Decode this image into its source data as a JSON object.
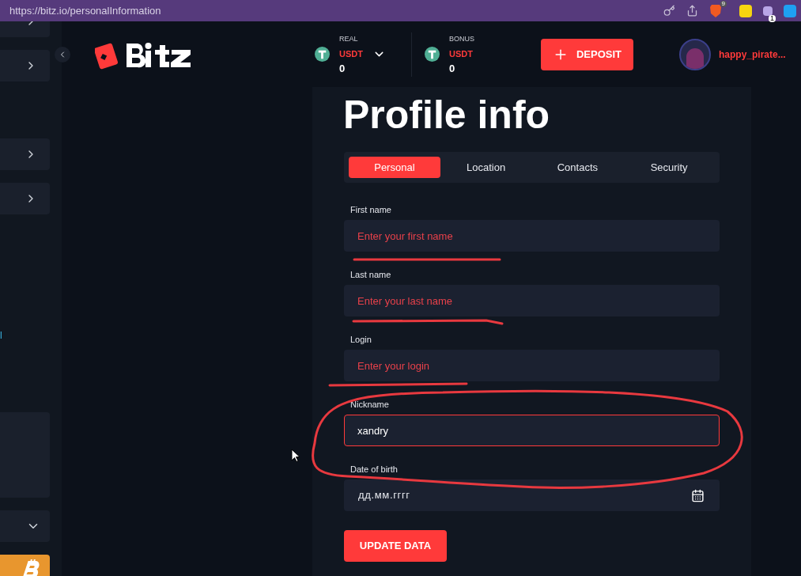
{
  "browser": {
    "url": "https://bitz.io/personalInformation",
    "brave_badge": "9",
    "extension_badge": "1"
  },
  "sidebar": {
    "items": [
      {
        "kind": "chevron"
      },
      {
        "kind": "chevron"
      },
      {
        "kind": "chevron"
      },
      {
        "kind": "chevron"
      },
      {
        "kind": "text",
        "text": "l"
      },
      {
        "kind": "panel"
      },
      {
        "kind": "dropdown"
      },
      {
        "kind": "bitcoin"
      }
    ]
  },
  "header": {
    "balances": [
      {
        "label": "REAL",
        "currency": "USDT",
        "amount": "0",
        "dropdown": true
      },
      {
        "label": "BONUS",
        "currency": "USDT",
        "amount": "0",
        "dropdown": false
      }
    ],
    "deposit": "DEPOSIT",
    "username": "happy_pirate..."
  },
  "title": "Profile info",
  "tabs": [
    {
      "label": "Personal",
      "selected": true
    },
    {
      "label": "Location",
      "selected": false
    },
    {
      "label": "Contacts",
      "selected": false
    },
    {
      "label": "Security",
      "selected": false
    }
  ],
  "fields": [
    {
      "kind": "text",
      "label": "First name",
      "placeholder": "Enter your first name",
      "focused": false
    },
    {
      "kind": "text",
      "label": "Last name",
      "placeholder": "Enter your last name",
      "focused": false
    },
    {
      "kind": "text",
      "label": "Login",
      "placeholder": "Enter your login",
      "focused": false
    },
    {
      "kind": "text",
      "label": "Nickname",
      "value": "xandry",
      "focused": true
    },
    {
      "kind": "date",
      "label": "Date of birth",
      "placeholder": "дд.мм.гггг",
      "focused": false
    }
  ],
  "submit": "UPDATE DATA"
}
